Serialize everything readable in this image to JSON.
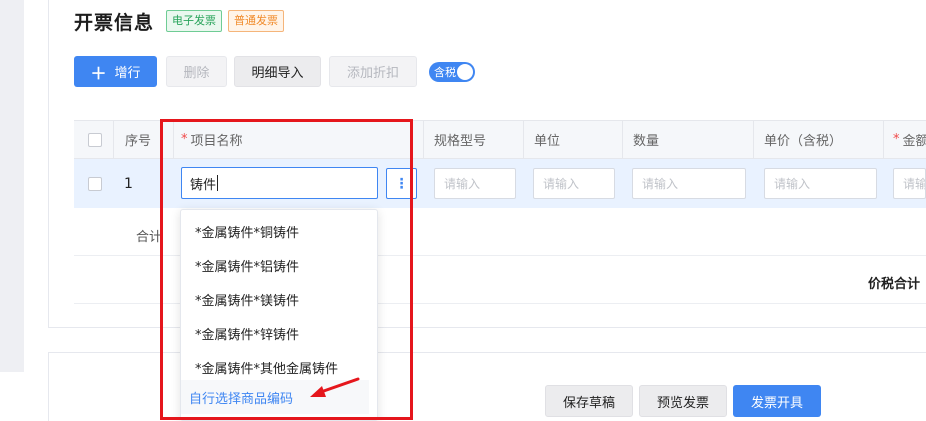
{
  "header": {
    "title": "开票信息",
    "tags": [
      "电子发票",
      "普通发票"
    ]
  },
  "toolbar": {
    "add_row": "增行",
    "delete": "删除",
    "import_detail": "明细导入",
    "add_discount": "添加折扣",
    "tax_toggle": "含税"
  },
  "table": {
    "columns": [
      "序号",
      "项目名称",
      "规格型号",
      "单位",
      "数量",
      "单价（含税）",
      "金额"
    ],
    "required_mark": "*",
    "row": {
      "index": "1",
      "name_value": "铸件",
      "placeholder": "请输入"
    },
    "subtotal_label": "合计",
    "total_label": "价税合计"
  },
  "dropdown": {
    "items": [
      "*金属铸件*铜铸件",
      "*金属铸件*铝铸件",
      "*金属铸件*镁铸件",
      "*金属铸件*锌铸件",
      "*金属铸件*其他金属铸件"
    ],
    "footer_link": "自行选择商品编码"
  },
  "footer": {
    "save_draft": "保存草稿",
    "preview": "预览发票",
    "issue": "发票开具"
  },
  "colors": {
    "primary": "#3f86f2",
    "highlight": "#e5161c"
  },
  "icons": {
    "add": "plus-icon",
    "more": "vertical-ellipsis-icon",
    "annotation": "red-arrow-icon"
  }
}
